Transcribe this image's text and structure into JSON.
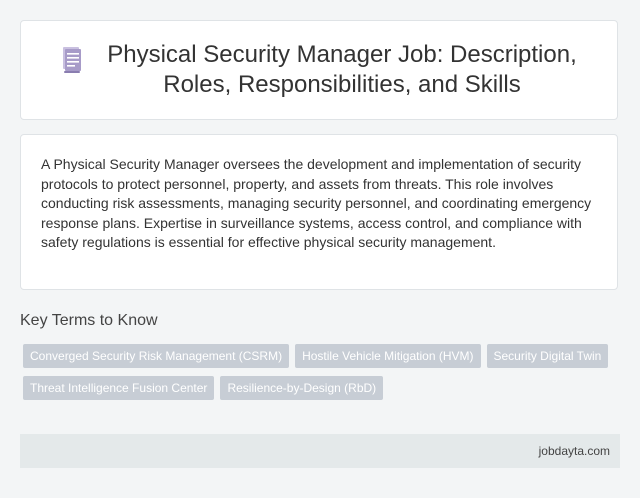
{
  "header": {
    "title": "Physical Security Manager Job: Description, Roles, Responsibilities, and Skills",
    "icon": "document-icon"
  },
  "description": {
    "text": "A Physical Security Manager oversees the development and implementation of security protocols to protect personnel, property, and assets from threats. This role involves conducting risk assessments, managing security personnel, and coordinating emergency response plans. Expertise in surveillance systems, access control, and compliance with safety regulations is essential for effective physical security management."
  },
  "key_terms": {
    "heading": "Key Terms to Know",
    "tags": [
      "Converged Security Risk Management (CSRM)",
      "Hostile Vehicle Mitigation (HVM)",
      "Security Digital Twin",
      "Threat Intelligence Fusion Center",
      "Resilience-by-Design (RbD)"
    ]
  },
  "footer": {
    "site": "jobdayta.com"
  },
  "colors": {
    "background": "#f3f5f6",
    "card": "#ffffff",
    "tag": "#c7cdd5",
    "footer": "#e4e9ea",
    "icon": "#a79bc8"
  }
}
